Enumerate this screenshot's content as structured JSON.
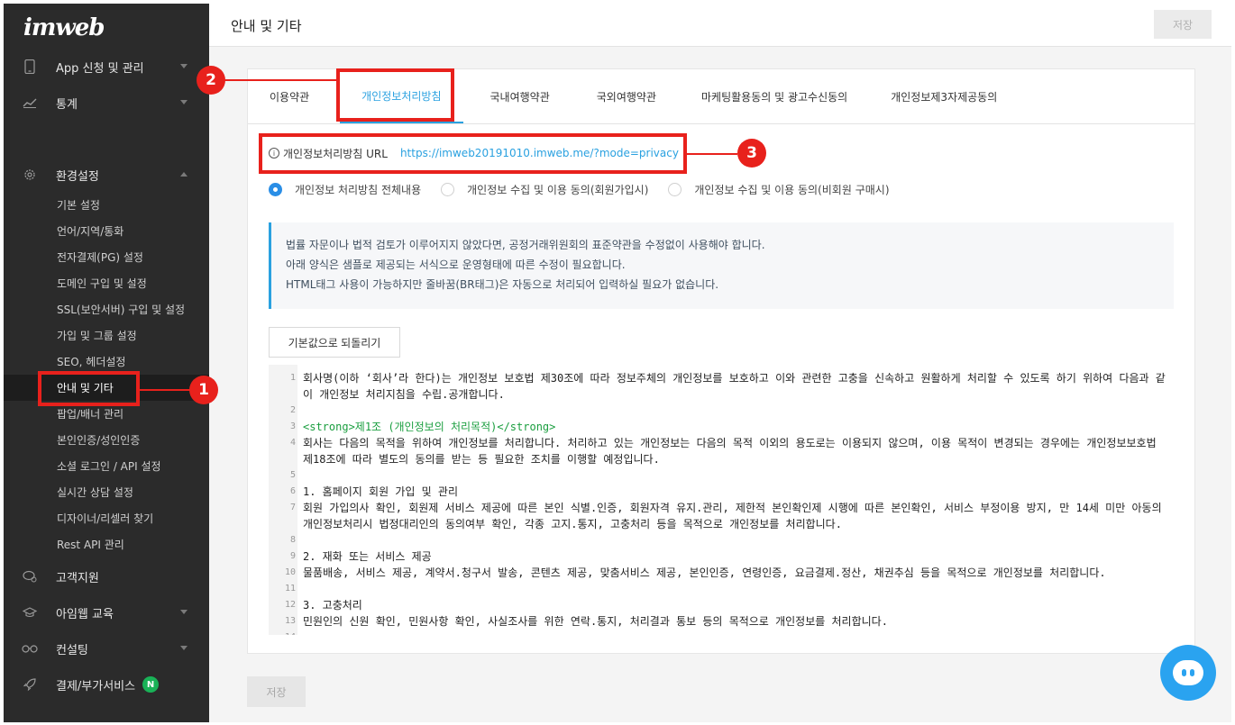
{
  "app": {
    "logo": "imweb"
  },
  "header": {
    "title": "안내 및 기타",
    "save_label": "저장"
  },
  "sidebar": {
    "top_items": [
      {
        "label": "App 신청 및 관리",
        "icon": "mobile-icon"
      },
      {
        "label": "통계",
        "icon": "chart-icon"
      }
    ],
    "settings": {
      "label": "환경설정",
      "icon": "gear-icon"
    },
    "sub_items": [
      "기본 설정",
      "언어/지역/통화",
      "전자결제(PG) 설정",
      "도메인 구입 및 설정",
      "SSL(보안서버) 구입 및 설정",
      "가입 및 그룹 설정",
      "SEO, 헤더설정",
      "안내 및 기타",
      "팝업/배너 관리",
      "본인인증/성인인증",
      "소셜 로그인 / API 설정",
      "실시간 상담 설정",
      "디자이너/리셀러 찾기",
      "Rest API 관리"
    ],
    "bottom_items": [
      {
        "label": "고객지원",
        "icon": "chat-icon"
      },
      {
        "label": "아임웹 교육",
        "icon": "graduation-icon"
      },
      {
        "label": "컨설팅",
        "icon": "glasses-icon"
      },
      {
        "label": "결제/부가서비스",
        "icon": "rocket-icon",
        "badge": "N"
      }
    ]
  },
  "tabs": [
    "이용약관",
    "개인정보처리방침",
    "국내여행약관",
    "국외여행약관",
    "마케팅활용동의 및 광고수신동의",
    "개인정보제3자제공동의"
  ],
  "url_row": {
    "label": "개인정보처리방침 URL",
    "url": "https://imweb20191010.imweb.me/?mode=privacy"
  },
  "radios": [
    {
      "label": "개인정보 처리방침 전체내용",
      "checked": true
    },
    {
      "label": "개인정보 수집 및 이용 동의(회원가입시)",
      "checked": false
    },
    {
      "label": "개인정보 수집 및 이용 동의(비회원 구매시)",
      "checked": false
    }
  ],
  "notice": {
    "line1": "법률 자문이나 법적 검토가 이루어지지 않았다면, 공정거래위원회의 표준약관을 수정없이 사용해야 합니다.",
    "line2": "아래 양식은 샘플로 제공되는 서식으로 운영형태에 따른 수정이 필요합니다.",
    "line3": "HTML태그 사용이 가능하지만 줄바꿈(BR태그)은 자동으로 처리되어 입력하실 필요가 없습니다."
  },
  "reset_label": "기본값으로 되돌리기",
  "code_lines": [
    {
      "n": "1",
      "text": "회사명(이하 ‘회사’라 한다)는 개인정보 보호법 제30조에 따라 정보주체의 개인정보를 보호하고 이와 관련한 고충을 신속하고 원활하게 처리할 수 있도록 하기 위하여 다음과 같이 개인정보 처리지침을 수립.공개합니다."
    },
    {
      "n": "2",
      "text": ""
    },
    {
      "n": "3",
      "text": "<strong>제1조 (개인정보의 처리목적)</strong>",
      "tag": true
    },
    {
      "n": "4",
      "text": "회사는 다음의 목적을 위하여 개인정보를 처리합니다. 처리하고 있는 개인정보는 다음의 목적 이외의 용도로는 이용되지 않으며, 이용 목적이 변경되는 경우에는 개인정보보호법 제18조에 따라 별도의 동의를 받는 등 필요한 조치를 이행할 예정입니다."
    },
    {
      "n": "5",
      "text": ""
    },
    {
      "n": "6",
      "text": "1. 홈페이지 회원 가입 및 관리"
    },
    {
      "n": "7",
      "text": "회원 가입의사 확인, 회원제 서비스 제공에 따른 본인 식별.인증, 회원자격 유지.관리, 제한적 본인확인제 시행에 따른 본인확인, 서비스 부정이용 방지, 만 14세 미만 아동의 개인정보처리시 법정대리인의 동의여부 확인, 각종 고지.통지, 고충처리 등을 목적으로 개인정보를 처리합니다."
    },
    {
      "n": "8",
      "text": ""
    },
    {
      "n": "9",
      "text": "2. 재화 또는 서비스 제공"
    },
    {
      "n": "10",
      "text": "물품배송, 서비스 제공, 계약서.청구서 발송, 콘텐츠 제공, 맞춤서비스 제공, 본인인증, 연령인증, 요금결제.정산, 채권추심 등을 목적으로 개인정보를 처리합니다."
    },
    {
      "n": "11",
      "text": ""
    },
    {
      "n": "12",
      "text": "3. 고충처리"
    },
    {
      "n": "13",
      "text": "민원인의 신원 확인, 민원사항 확인, 사실조사를 위한 연락.통지, 처리결과 통보 등의 목적으로 개인정보를 처리합니다."
    },
    {
      "n": "14",
      "text": ""
    }
  ],
  "footer": {
    "save_label": "저장"
  },
  "callouts": {
    "one": "1",
    "two": "2",
    "three": "3"
  },
  "colors": {
    "accent": "#2aa1e0",
    "annotation": "#e8211c",
    "sidebar_bg": "#2b2b2b"
  }
}
